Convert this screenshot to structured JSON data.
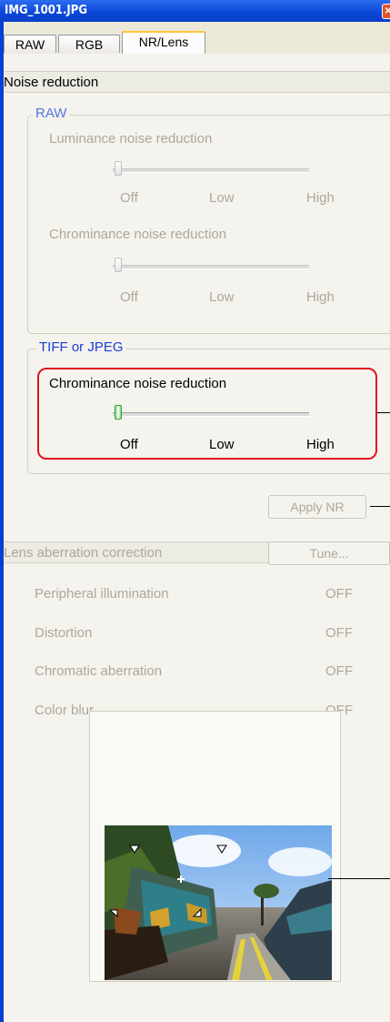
{
  "window": {
    "title": "IMG_1001.JPG",
    "close_glyph": "✕"
  },
  "tabs": [
    {
      "label": "RAW",
      "active": false
    },
    {
      "label": "RGB",
      "active": false
    },
    {
      "label": "NR/Lens",
      "active": true
    }
  ],
  "noise_reduction": {
    "header": "Noise reduction",
    "raw_group": {
      "legend": "RAW",
      "luminance": {
        "label": "Luminance noise reduction",
        "value": 0,
        "ticks": [
          "Off",
          "Low",
          "High"
        ]
      },
      "chrominance": {
        "label": "Chrominance noise reduction",
        "value": 0,
        "ticks": [
          "Off",
          "Low",
          "High"
        ]
      }
    },
    "tiff_group": {
      "legend": "TIFF or JPEG",
      "chrominance": {
        "label": "Chrominance noise reduction",
        "value": 0,
        "ticks": [
          "Off",
          "Low",
          "High"
        ]
      }
    },
    "apply_button": "Apply NR"
  },
  "lens": {
    "header": "Lens aberration correction",
    "tune_button": "Tune...",
    "items": [
      {
        "label": "Peripheral illumination",
        "value": "OFF"
      },
      {
        "label": "Distortion",
        "value": "OFF"
      },
      {
        "label": "Chromatic aberration",
        "value": "OFF"
      },
      {
        "label": "Color blur",
        "value": "OFF"
      }
    ]
  },
  "colors": {
    "title_bar": "#0a45d6",
    "accent_legend": "#1a3dd6",
    "callout": "#e2141e",
    "disabled_text": "#aca899"
  },
  "icons": [
    "close-icon",
    "crosshair-icon",
    "corner-marker-icon"
  ]
}
